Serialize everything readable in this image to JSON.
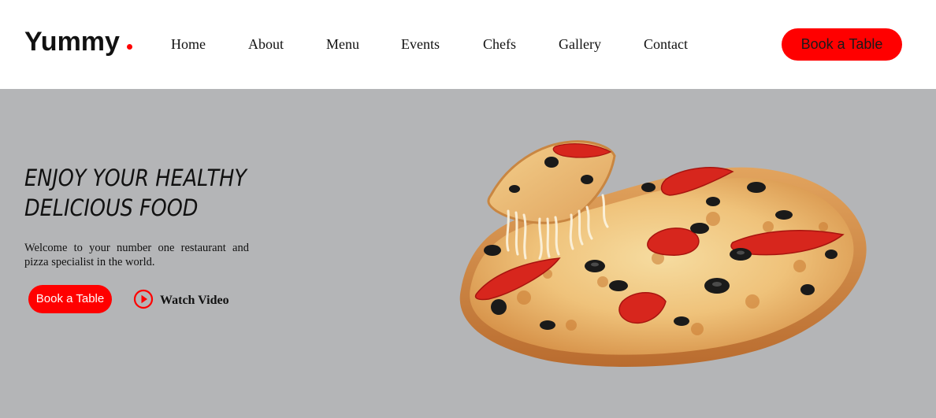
{
  "header": {
    "logo": "Yummy",
    "nav": [
      "Home",
      "About",
      "Menu",
      "Events",
      "Chefs",
      "Gallery",
      "Contact"
    ],
    "book_button": "Book a Table"
  },
  "hero": {
    "title_line1": "Enjoy Your Healthy",
    "title_line2": "Delicious Food",
    "description": "Welcome to your number one restaurant and pizza specialist in the world.",
    "book_button": "Book a Table",
    "watch_video": "Watch Video",
    "image": "pizza-with-cheese-pull"
  },
  "colors": {
    "accent": "#ff0000",
    "hero_background": "#b4b5b7",
    "header_background": "#ffffff"
  }
}
